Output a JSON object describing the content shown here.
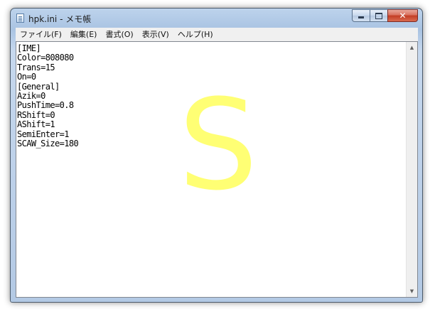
{
  "window": {
    "title": "hpk.ini - メモ帳"
  },
  "menu": {
    "items": [
      "ファイル(F)",
      "編集(E)",
      "書式(O)",
      "表示(V)",
      "ヘルプ(H)"
    ]
  },
  "editor": {
    "lines": [
      "[IME]",
      "Color=808080",
      "Trans=15",
      "On=0",
      "[General]",
      "Azik=0",
      "PushTime=0.8",
      "RShift=0",
      "AShift=1",
      "SemiEnter=1",
      "SCAW_Size=180"
    ],
    "overlay_letter": "S"
  },
  "colors": {
    "overlay": "#ffff66",
    "close_button": "#c33d24",
    "title_bar": "#bdd3ec"
  },
  "icons": {
    "app": "notepad-icon",
    "minimize": "minimize-icon",
    "maximize": "maximize-icon",
    "close": "close-icon",
    "scroll_up": "arrow-up-icon",
    "scroll_down": "arrow-down-icon"
  }
}
